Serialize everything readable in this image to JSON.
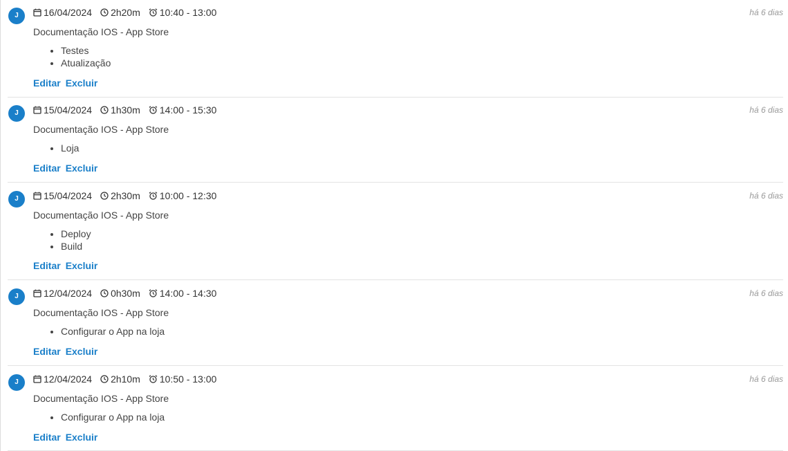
{
  "entries": [
    {
      "avatar": "J",
      "date": "16/04/2024",
      "duration": "2h20m",
      "time_range": "10:40 - 13:00",
      "ago": "há 6 dias",
      "title": "Documentação IOS - App Store",
      "items": [
        "Testes",
        "Atualização"
      ],
      "edit_label": "Editar",
      "delete_label": "Excluir"
    },
    {
      "avatar": "J",
      "date": "15/04/2024",
      "duration": "1h30m",
      "time_range": "14:00 - 15:30",
      "ago": "há 6 dias",
      "title": "Documentação IOS - App Store",
      "items": [
        "Loja"
      ],
      "edit_label": "Editar",
      "delete_label": "Excluir"
    },
    {
      "avatar": "J",
      "date": "15/04/2024",
      "duration": "2h30m",
      "time_range": "10:00 - 12:30",
      "ago": "há 6 dias",
      "title": "Documentação IOS - App Store",
      "items": [
        "Deploy",
        "Build"
      ],
      "edit_label": "Editar",
      "delete_label": "Excluir"
    },
    {
      "avatar": "J",
      "date": "12/04/2024",
      "duration": "0h30m",
      "time_range": "14:00 - 14:30",
      "ago": "há 6 dias",
      "title": "Documentação IOS - App Store",
      "items": [
        "Configurar o App na loja"
      ],
      "edit_label": "Editar",
      "delete_label": "Excluir"
    },
    {
      "avatar": "J",
      "date": "12/04/2024",
      "duration": "2h10m",
      "time_range": "10:50 - 13:00",
      "ago": "há 6 dias",
      "title": "Documentação IOS - App Store",
      "items": [
        "Configurar o App na loja"
      ],
      "edit_label": "Editar",
      "delete_label": "Excluir"
    }
  ],
  "icons": {
    "date": "calendar-icon",
    "duration": "clock-icon",
    "time_range": "alarm-clock-icon"
  },
  "colors": {
    "accent": "#1a7fc9",
    "muted": "#9a9a9a",
    "divider": "#e3e3e3"
  }
}
